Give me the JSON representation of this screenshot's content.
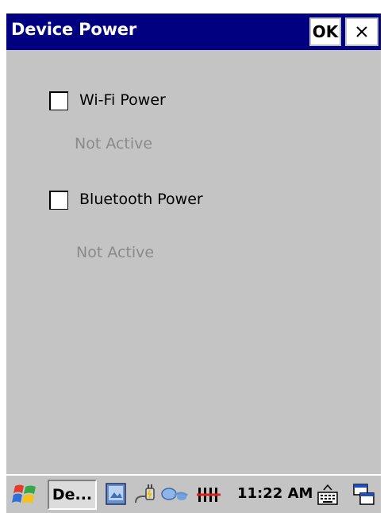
{
  "window": {
    "title": "Device Power",
    "ok_label": "OK",
    "close_label": "×"
  },
  "options": [
    {
      "label": "Wi-Fi Power",
      "checked": false,
      "status": "Not Active"
    },
    {
      "label": "Bluetooth Power",
      "checked": false,
      "status": "Not Active"
    }
  ],
  "taskbar": {
    "task_label": "De...",
    "clock": "11:22 AM",
    "icons": [
      "start-icon",
      "desktop-icon",
      "power-plug-icon",
      "network-icon",
      "signal-bars-icon",
      "keyboard-icon",
      "window-switch-icon"
    ]
  },
  "colors": {
    "titlebar": "#000080",
    "client": "#c4c4c4",
    "status_text": "#8a8a8a"
  }
}
